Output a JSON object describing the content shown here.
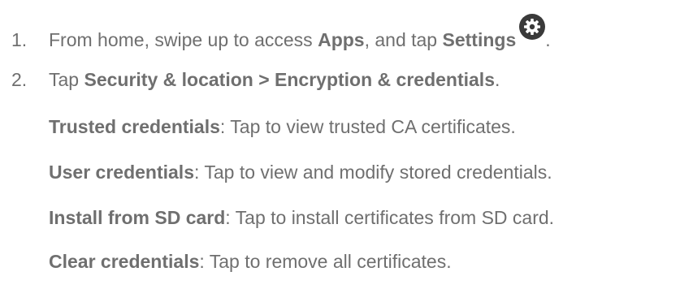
{
  "steps": [
    {
      "number": "1.",
      "prefix": "From home, swipe up to access ",
      "bold1": "Apps",
      "middle": ", and tap ",
      "bold2": "Settings",
      "icon": "settings-gear-icon",
      "suffix": "."
    },
    {
      "number": "2.",
      "prefix": "Tap ",
      "bold1": "Security & location > Encryption & credentials",
      "suffix": "."
    }
  ],
  "options": [
    {
      "term": "Trusted credentials",
      "desc": ": Tap to view trusted CA certificates."
    },
    {
      "term": "User credentials",
      "desc": ": Tap to view and modify stored credentials."
    },
    {
      "term": "Install from SD card",
      "desc": ": Tap to install certificates from SD card."
    },
    {
      "term": "Clear credentials",
      "desc": ": Tap to remove all certificates."
    }
  ],
  "colors": {
    "text": "#6f6f6f",
    "icon": "#3a3a3a"
  }
}
